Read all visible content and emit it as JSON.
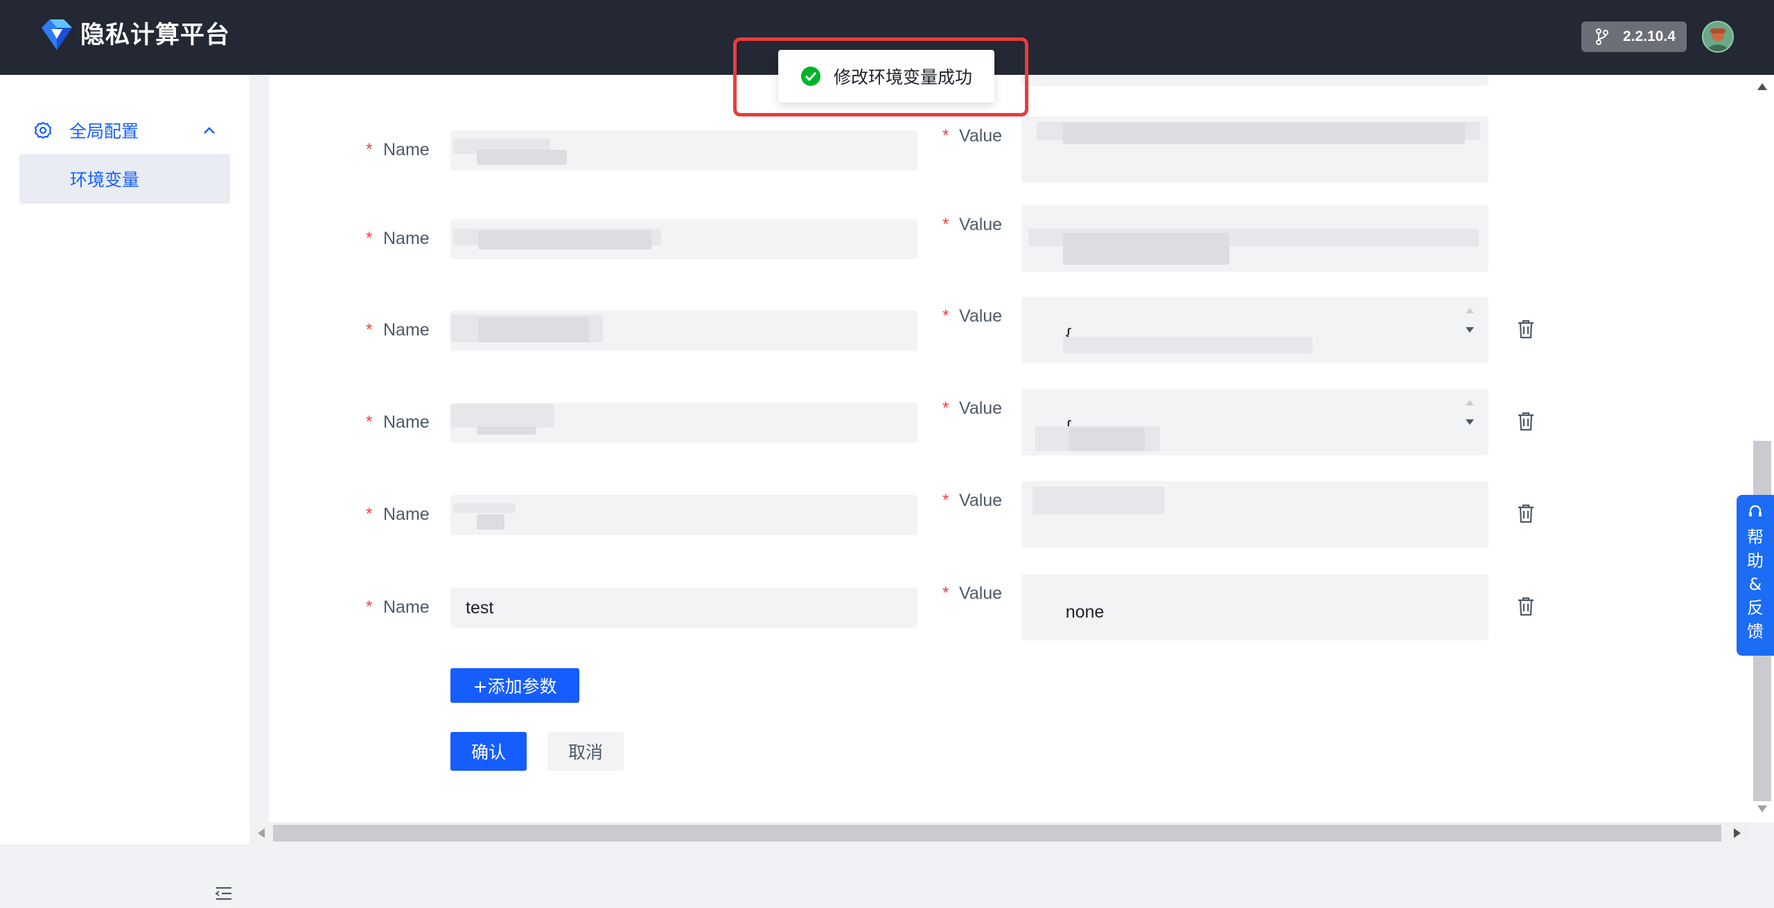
{
  "header": {
    "brand": "隐私计算平台",
    "version": "2.2.10.4"
  },
  "sidebar": {
    "group_label": "全局配置",
    "items": [
      {
        "label": "环境变量"
      }
    ]
  },
  "form": {
    "name_label": "Name",
    "value_label": "Value",
    "required_mark": "*",
    "rows": [
      {
        "name": "",
        "value": ""
      },
      {
        "name": "",
        "value": ""
      },
      {
        "name": "",
        "value": "{"
      },
      {
        "name": "",
        "value": "{"
      },
      {
        "name": "",
        "value": ""
      },
      {
        "name": "test",
        "value": "none"
      }
    ],
    "add_button": "+添加参数",
    "confirm_button": "确认",
    "cancel_button": "取消"
  },
  "help": {
    "label": "帮助&反馈"
  },
  "toast": {
    "message": "修改环境变量成功"
  },
  "colors": {
    "primary": "#165dff",
    "header_bg": "#232834",
    "required": "#f53f3f",
    "success": "#00b42a",
    "highlight": "#ea3b3b"
  }
}
